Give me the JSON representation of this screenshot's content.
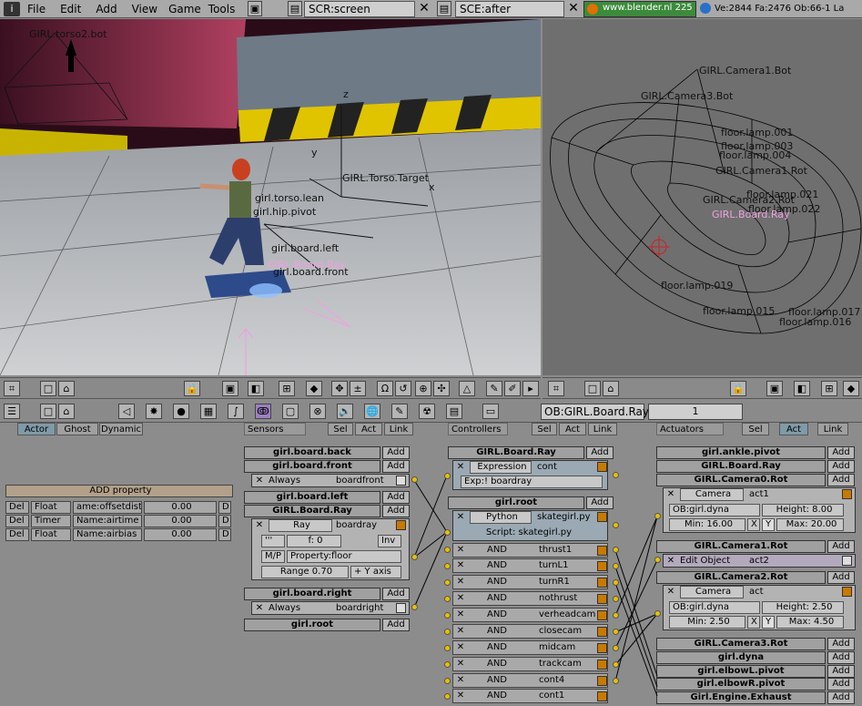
{
  "menubar": {
    "menus": [
      "File",
      "Edit",
      "Add",
      "View",
      "Game",
      "Tools"
    ],
    "screen": "SCR:screen",
    "scene": "SCE:after",
    "site": "www.blender.nl 225",
    "stats": "Ve:2844  Fa:2476  Ob:66-1  La"
  },
  "viewport_left": {
    "labels": {
      "torso_bot": "GIRL.torso2.bot",
      "torso_target": "GIRL.Torso.Target",
      "torso_lean": "girl.torso.lean",
      "hip_pivot": "girl.hip.pivot",
      "board_left": "girl.board.left",
      "board_ray": "GIRL.Board.Ray",
      "board_front": "girl.board.front",
      "axis_x": "x",
      "axis_y": "y",
      "axis_z": "z"
    }
  },
  "viewport_right": {
    "labels": {
      "cam1": "GIRL.Camera1.Bot",
      "cam3": "GIRL.Camera3.Bot",
      "lamp001": "floor.lamp.001",
      "lamp003": "floor.lamp.003",
      "lamp004": "floor.lamp.004",
      "lamp021": "floor.lamp.021",
      "lamp022": "floor.lamp.022",
      "lamp019": "floor.lamp.019",
      "lamp015": "floor.lamp.015",
      "lamp017": "floor.lamp.017",
      "lamp016": "floor.lamp.016",
      "cam_rot": "GIRL.Camera1.Rot",
      "cam2": "GIRL.Camera2.Rot",
      "board_ray": "GIRL.Board.Ray"
    }
  },
  "logic_header": {
    "object_name": "OB:GIRL.Board.Ray",
    "count": "1"
  },
  "physics_tabs": [
    "Actor",
    "Ghost",
    "Dynamic"
  ],
  "properties": {
    "add_label": "ADD property",
    "rows": [
      {
        "del": "Del",
        "type": "Float",
        "name": "ame:offsetdist",
        "value": "0.00",
        "d": "D"
      },
      {
        "del": "Del",
        "type": "Timer",
        "name": "Name:airtime",
        "value": "0.00",
        "d": "D"
      },
      {
        "del": "Del",
        "type": "Float",
        "name": "Name:airbias",
        "value": "0.00",
        "d": "D"
      }
    ]
  },
  "sensors": {
    "title": "Sensors",
    "tabs": [
      "Sel",
      "Act",
      "Link"
    ],
    "add": "Add",
    "board_back": "girl.board.back",
    "board_front": "girl.board.front",
    "always": "Always",
    "boardfront": "boardfront",
    "board_left": "girl.board.left",
    "board_ray": "GIRL.Board.Ray",
    "ray": "Ray",
    "boardray": "boardray",
    "f0": "f: 0",
    "inv": "Inv",
    "mp": "M/P",
    "property_floor": "Property:floor",
    "range": "Range 0.70",
    "axis": "+ Y axis",
    "board_right": "girl.board.right",
    "always2": "Always",
    "boardright": "boardright",
    "root": "girl.root"
  },
  "controllers": {
    "title": "Controllers",
    "tabs": [
      "Sel",
      "Act",
      "Link"
    ],
    "add": "Add",
    "board_ray": "GIRL.Board.Ray",
    "expression": "Expression",
    "cont": "cont",
    "exp": "Exp:! boardray",
    "root": "girl.root",
    "python": "Python",
    "script_name": "skategirl.py",
    "script": "Script: skategirl.py",
    "and_label": "AND",
    "rows": [
      "thrust1",
      "turnL1",
      "turnR1",
      "nothrust",
      "verheadcam",
      "closecam",
      "midcam",
      "trackcam",
      "cont4",
      "cont1"
    ]
  },
  "actuators": {
    "title": "Actuators",
    "tabs": [
      "Sel",
      "Act",
      "Link"
    ],
    "add": "Add",
    "ankle": "girl.ankle.pivot",
    "board_ray": "GIRL.Board.Ray",
    "cam0": "GIRL.Camera0.Rot",
    "camera": "Camera",
    "act1": "act1",
    "ob_dyna": "OB:girl.dyna",
    "height1": "Height: 8.00",
    "min1": "Min: 16.00",
    "x": "X",
    "y": "Y",
    "max1": "Max: 20.00",
    "cam1": "GIRL.Camera1.Rot",
    "edit_object": "Edit Object",
    "act2": "act2",
    "cam2": "GIRL.Camera2.Rot",
    "camera2": "Camera",
    "act": "act",
    "ob_dyna2": "OB:girl.dyna",
    "height2": "Height: 2.50",
    "min2": "Min: 2.50",
    "max2": "Max: 4.50",
    "cam3": "GIRL.Camera3.Rot",
    "dyna": "girl.dyna",
    "elbowL": "girl.elbowL.pivot",
    "elbowR": "girl.elbowR.pivot",
    "exhaust": "Girl.Engine.Exhaust"
  }
}
